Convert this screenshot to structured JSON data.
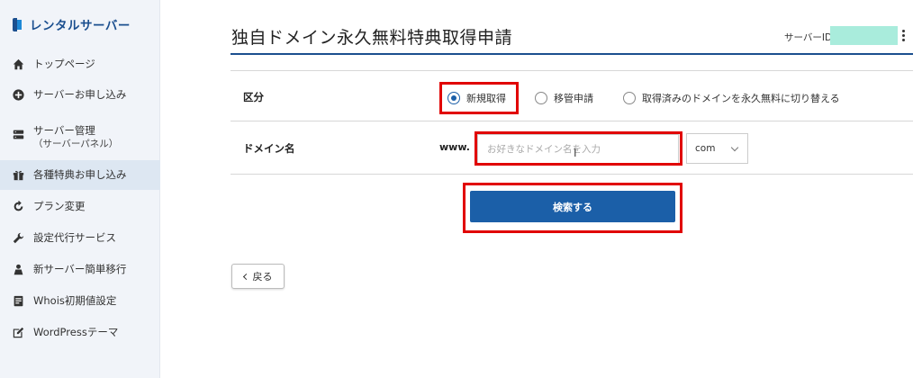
{
  "sidebar": {
    "brand": "レンタルサーバー",
    "items": [
      {
        "label": "トップページ",
        "icon": "home-icon"
      },
      {
        "label": "サーバーお申し込み",
        "icon": "plus-circle-icon"
      },
      {
        "label": "サーバー管理",
        "sub": "（サーバーパネル）",
        "icon": "server-icon"
      },
      {
        "label": "各種特典お申し込み",
        "icon": "gift-icon",
        "active": true
      },
      {
        "label": "プラン変更",
        "icon": "refresh-icon"
      },
      {
        "label": "設定代行サービス",
        "icon": "wrench-icon"
      },
      {
        "label": "新サーバー簡単移行",
        "icon": "migrate-icon"
      },
      {
        "label": "Whois初期値設定",
        "icon": "document-icon"
      },
      {
        "label": "WordPressテーマ",
        "icon": "edit-icon"
      }
    ]
  },
  "header": {
    "title": "独自ドメイン永久無料特典取得申請",
    "server_id_label": "サーバーID",
    "server_id_value": ""
  },
  "form": {
    "category_label": "区分",
    "options": [
      {
        "label": "新規取得",
        "checked": true
      },
      {
        "label": "移管申請",
        "checked": false
      },
      {
        "label": "取得済みのドメインを永久無料に切り替える",
        "checked": false
      }
    ],
    "domain_label": "ドメイン名",
    "www_prefix": "www.",
    "domain_placeholder": "お好きなドメイン名を入力",
    "tld_selected": "com",
    "search_button": "検索する"
  },
  "back_button": "戻る",
  "colors": {
    "accent": "#1b5fa8",
    "brand": "#1b4f8f",
    "highlight": "#e10000",
    "server_id_mask": "#a9ecdc"
  }
}
